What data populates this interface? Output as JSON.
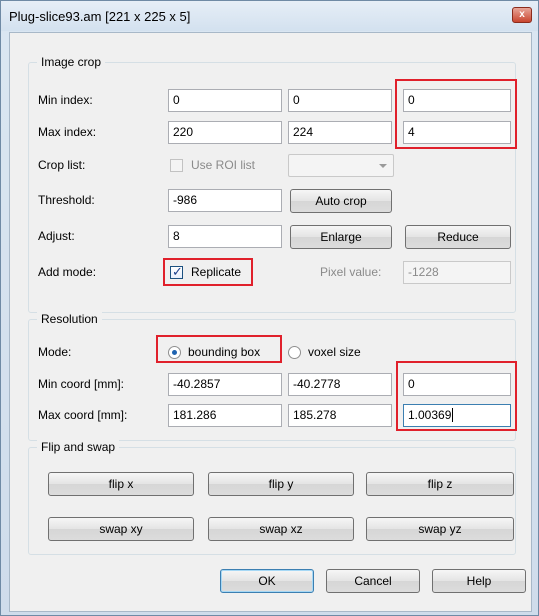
{
  "window": {
    "title": "Plug-slice93.am [221 x 225 x 5]",
    "close": "x"
  },
  "image_crop": {
    "group_title": "Image crop",
    "min_index_label": "Min index:",
    "min_index": [
      "0",
      "0",
      "0"
    ],
    "max_index_label": "Max index:",
    "max_index": [
      "220",
      "224",
      "4"
    ],
    "crop_list_label": "Crop list:",
    "use_roi_label": "Use ROI list",
    "threshold_label": "Threshold:",
    "threshold_value": "-986",
    "auto_crop": "Auto crop",
    "adjust_label": "Adjust:",
    "adjust_value": "8",
    "enlarge": "Enlarge",
    "reduce": "Reduce",
    "add_mode_label": "Add mode:",
    "replicate_label": "Replicate",
    "replicate_checked": true,
    "pixel_value_label": "Pixel value:",
    "pixel_value": "-1228"
  },
  "resolution": {
    "group_title": "Resolution",
    "mode_label": "Mode:",
    "bounding_box_label": "bounding box",
    "voxel_size_label": "voxel size",
    "selected_mode": "bounding box",
    "min_coord_label": "Min coord [mm]:",
    "min_coord": [
      "-40.2857",
      "-40.2778",
      "0"
    ],
    "max_coord_label": "Max coord [mm]:",
    "max_coord": [
      "181.286",
      "185.278",
      "1.00369"
    ]
  },
  "flip_swap": {
    "group_title": "Flip and swap",
    "flip_x": "flip x",
    "flip_y": "flip y",
    "flip_z": "flip z",
    "swap_xy": "swap xy",
    "swap_xz": "swap xz",
    "swap_yz": "swap yz"
  },
  "footer": {
    "ok": "OK",
    "cancel": "Cancel",
    "help": "Help"
  },
  "colors": {
    "highlight": "#e0202b",
    "title_bg": "#d3e1ef",
    "dialog_bg": "#f0f0f0"
  }
}
